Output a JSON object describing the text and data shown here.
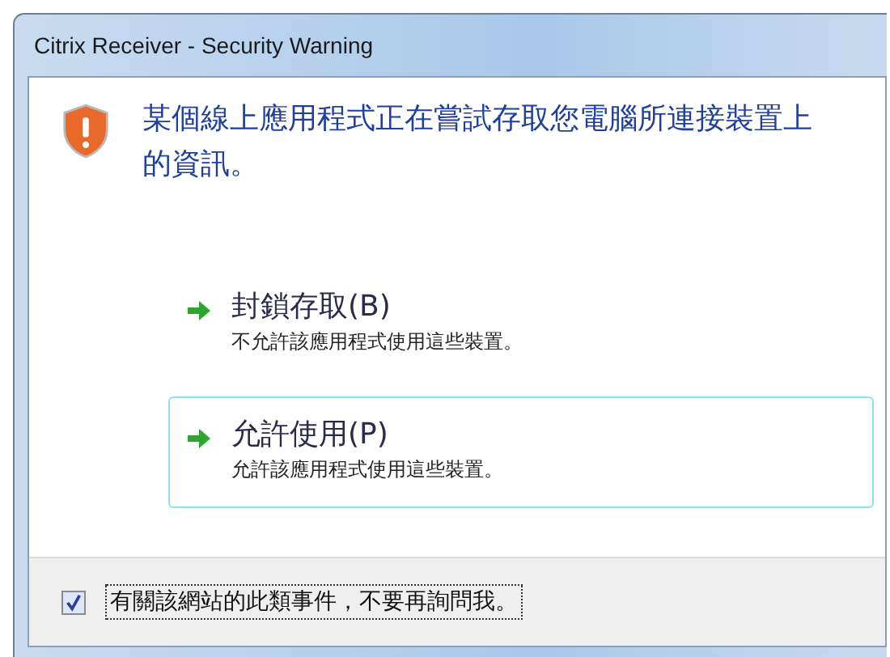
{
  "window": {
    "title": "Citrix Receiver - Security Warning"
  },
  "message": "某個線上應用程式正在嘗試存取您電腦所連接裝置上的資訊。",
  "options": [
    {
      "title": "封鎖存取(B)",
      "description": "不允許該應用程式使用這些裝置。",
      "selected": false
    },
    {
      "title": "允許使用(P)",
      "description": "允許該應用程式使用這些裝置。",
      "selected": true
    }
  ],
  "footer": {
    "checkbox": {
      "label": "有關該網站的此類事件，不要再詢問我。",
      "checked": true
    }
  }
}
